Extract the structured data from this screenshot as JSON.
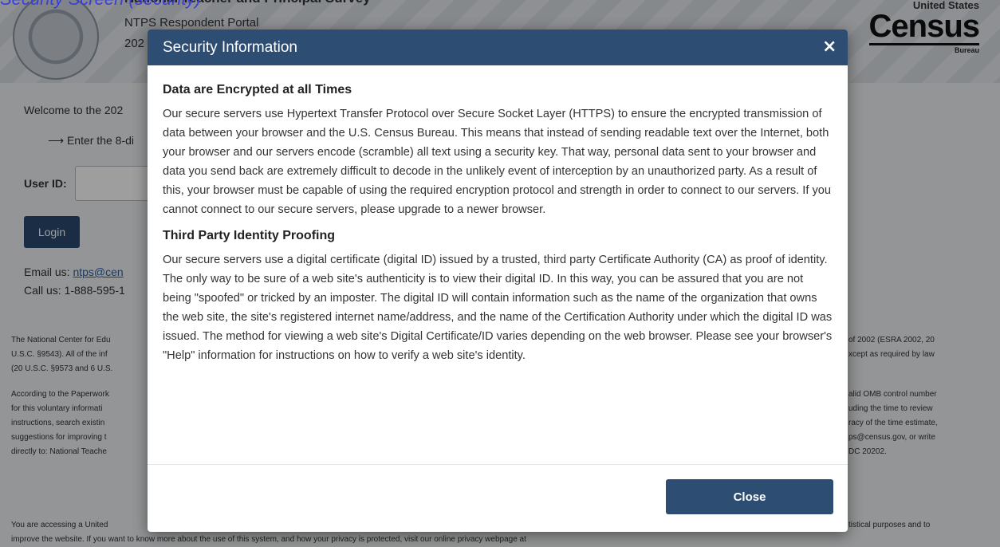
{
  "background": {
    "top_link": "Security Screen (security)",
    "title": "National Teacher and Principal Survey",
    "portal_name": "NTPS Respondent Portal",
    "year": "202",
    "census_logo": {
      "small": "United States",
      "big": "Census",
      "bureau": "Bureau"
    },
    "welcome": "Welcome to the 202",
    "enter_instruction": "⟶ Enter the 8-di",
    "userid_label": "User ID:",
    "login_label": "Login",
    "email_prefix": "Email us:",
    "email_link": "ntps@cen",
    "call": "Call us: 1-888-595-1",
    "para1_left": "The National Center for Edu\nU.S.C. §9543). All of the inf\n(20 U.S.C. §9573 and 6 U.S.",
    "para1_right": "of 2002 (ESRA 2002, 20\nxcept as required by law",
    "para2_left": "According to the Paperwork\nfor this voluntary informati\ninstructions, search existin\nsuggestions for improving t\ndirectly to: National Teache",
    "para2_right": "alid OMB control number\nuding the time to review\nracy of the time estimate,\nps@census.gov, or write\nDC 20202.",
    "para3_left": "You are accessing a United\nimprove the website. If you want to know more about the use of this system, and how your privacy is protected, visit our online privacy webpage at",
    "para3_right": "tistical purposes and to"
  },
  "modal": {
    "title": "Security Information",
    "close_icon": "close-icon",
    "sections": [
      {
        "heading": "Data are Encrypted at all Times",
        "text": "Our secure servers use Hypertext Transfer Protocol over Secure Socket Layer (HTTPS) to ensure the encrypted transmission of data between your browser and the U.S. Census Bureau. This means that instead of sending readable text over the Internet, both your browser and our servers encode (scramble) all text using a security key. That way, personal data sent to your browser and data you send back are extremely difficult to decode in the unlikely event of interception by an unauthorized party. As a result of this, your browser must be capable of using the required encryption protocol and strength in order to connect to our servers. If you cannot connect to our secure servers, please upgrade to a newer browser."
      },
      {
        "heading": "Third Party Identity Proofing",
        "text": "Our secure servers use a digital certificate (digital ID) issued by a trusted, third party Certificate Authority (CA) as proof of identity. The only way to be sure of a web site's authenticity is to view their digital ID. In this way, you can be assured that you are not being \"spoofed\" or tricked by an imposter. The digital ID will contain information such as the name of the organization that owns the web site, the site's registered internet name/address, and the name of the Certification Authority under which the digital ID was issued. The method for viewing a web site's Digital Certificate/ID varies depending on the web browser. Please see your browser's \"Help\" information for instructions on how to verify a web site's identity."
      }
    ],
    "close_button_label": "Close",
    "close_x_glyph": "×"
  },
  "colors": {
    "modal_header": "#2e4d73",
    "button": "#2e4d73",
    "link": "#2a5fa8"
  }
}
